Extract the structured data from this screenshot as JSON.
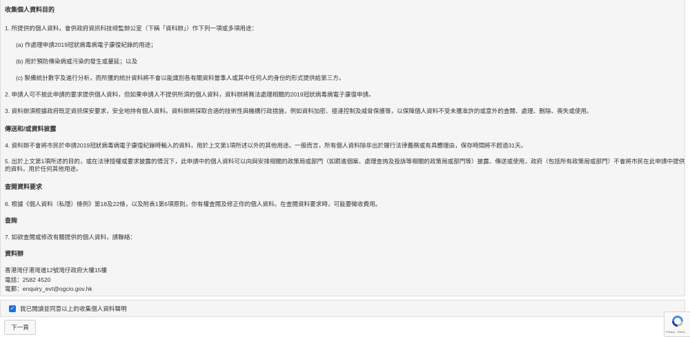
{
  "section_collection": {
    "title": "收集個人資料目的",
    "item1": "1.  所提供的個人資料，會供政府資訊科技總監辦公室（下稱「資科辦」）作下列一項或多項用途：",
    "item1a": "(a)  作處理申請2019冠狀病毒病電子康復紀錄的用途；",
    "item1b": "(b)  用於預防傳染病或污染的發生或蔓延；以及",
    "item1c": "(c)  製備統計數字及進行分析，而所獲的統計資料將不會以能識別各有關資料當事人或其中任何人的身份的形式提供給第三方。",
    "item2": "2.  申請人可不按此申請的要求提供個人資料，但如果申請人不提供所須的個人資料，資料辦將無法處理相關的2019冠狀病毒病電子康復申請。",
    "item3": "3.  資料辦須根據政府既定資訊保安要求，安全地持有個人資料。資料辦將採取合適的技術性與機構行政措施，例如資料加密、接達控制及威脅保護等，以保障個人資料不受未獲准許的或意外的查閱、處理、刪除、喪失或使用。"
  },
  "section_transfer": {
    "title": "傳送和/或資料披露",
    "item4": "4.  資料辦不會將市民於申請2019冠狀病毒病電子康復紀錄時輸入的資料，用於上文第1項所述以外的其他用途。一般而言，所有個人資料除非出於履行法律義務或有具體理由，保存時間將不超過31天。",
    "item5": "5.  出於上文第1項所述的目的，或在法律授權或要求披露的情況下，此申請中的個人資料可以向與安排相關的政策局或部門（如跟進個案、處理查詢及投訴等相關的政策局或部門等）披露、傳送或使用，政府（包括所有政策局或部門）不會將市民在此申請中提供的資料，用於任何其他用途。"
  },
  "section_access": {
    "title": "查閱資料要求",
    "item6": "6.  根據《個人資料（私隱）條例》第18及22條，以及附表1第6項原則，你有權查閱及修正你的個人資料。在查閱資料要求時，可能要徵收費用。"
  },
  "section_enquiry": {
    "title": "查詢",
    "item7": "7.  如欲查閱或修改有關提供的個人資料，請聯絡："
  },
  "contact": {
    "title": "資料辦",
    "address": "香港灣仔港灣道12號灣仔政府大樓15樓",
    "phone": "電話：2582 4520",
    "email": "電郵：enquiry_evt@ogcio.gov.hk"
  },
  "consent": {
    "checked": true,
    "check_mark": "✓",
    "label": "我已閱讀並同意以上的收集個人資料聲明"
  },
  "next_button": {
    "label": "下一頁"
  },
  "recaptcha": {
    "footer": "Privacy - Terms",
    "brand_color": "#1c3aa9"
  }
}
